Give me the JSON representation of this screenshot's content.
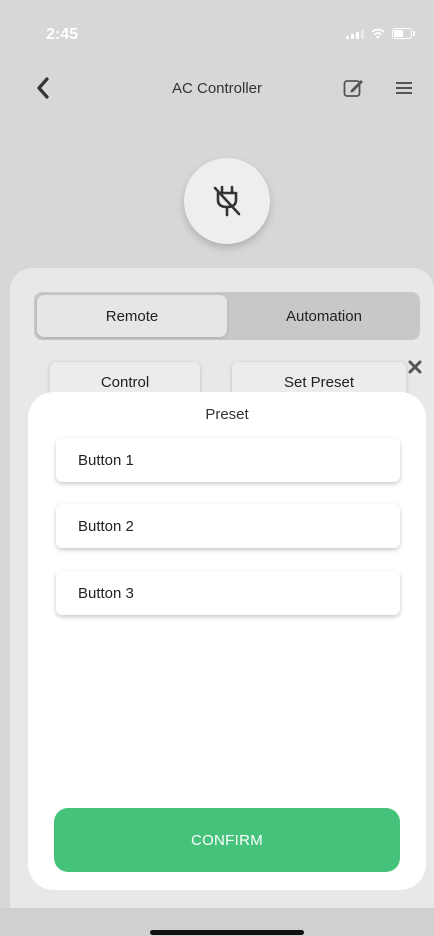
{
  "status_bar": {
    "time": "2:45",
    "icons": [
      "signal-icon",
      "wifi-icon",
      "battery-icon"
    ]
  },
  "header": {
    "title": "AC Controller",
    "back_icon": "chevron-left-icon",
    "edit_icon": "edit-icon",
    "menu_icon": "menu-icon"
  },
  "device": {
    "icon": "unplugged-icon"
  },
  "tabs": [
    {
      "label": "Remote",
      "selected": true
    },
    {
      "label": "Automation",
      "selected": false
    }
  ],
  "actions": {
    "control_label": "Control",
    "set_preset_label": "Set Preset"
  },
  "sheet": {
    "title": "Preset",
    "items": [
      {
        "label": "Button 1"
      },
      {
        "label": "Button 2"
      },
      {
        "label": "Button 3"
      }
    ],
    "confirm_label": "CONFIRM"
  },
  "colors": {
    "confirm": "#45c37a",
    "background": "#d7d7d7",
    "sheet": "#ffffff"
  }
}
